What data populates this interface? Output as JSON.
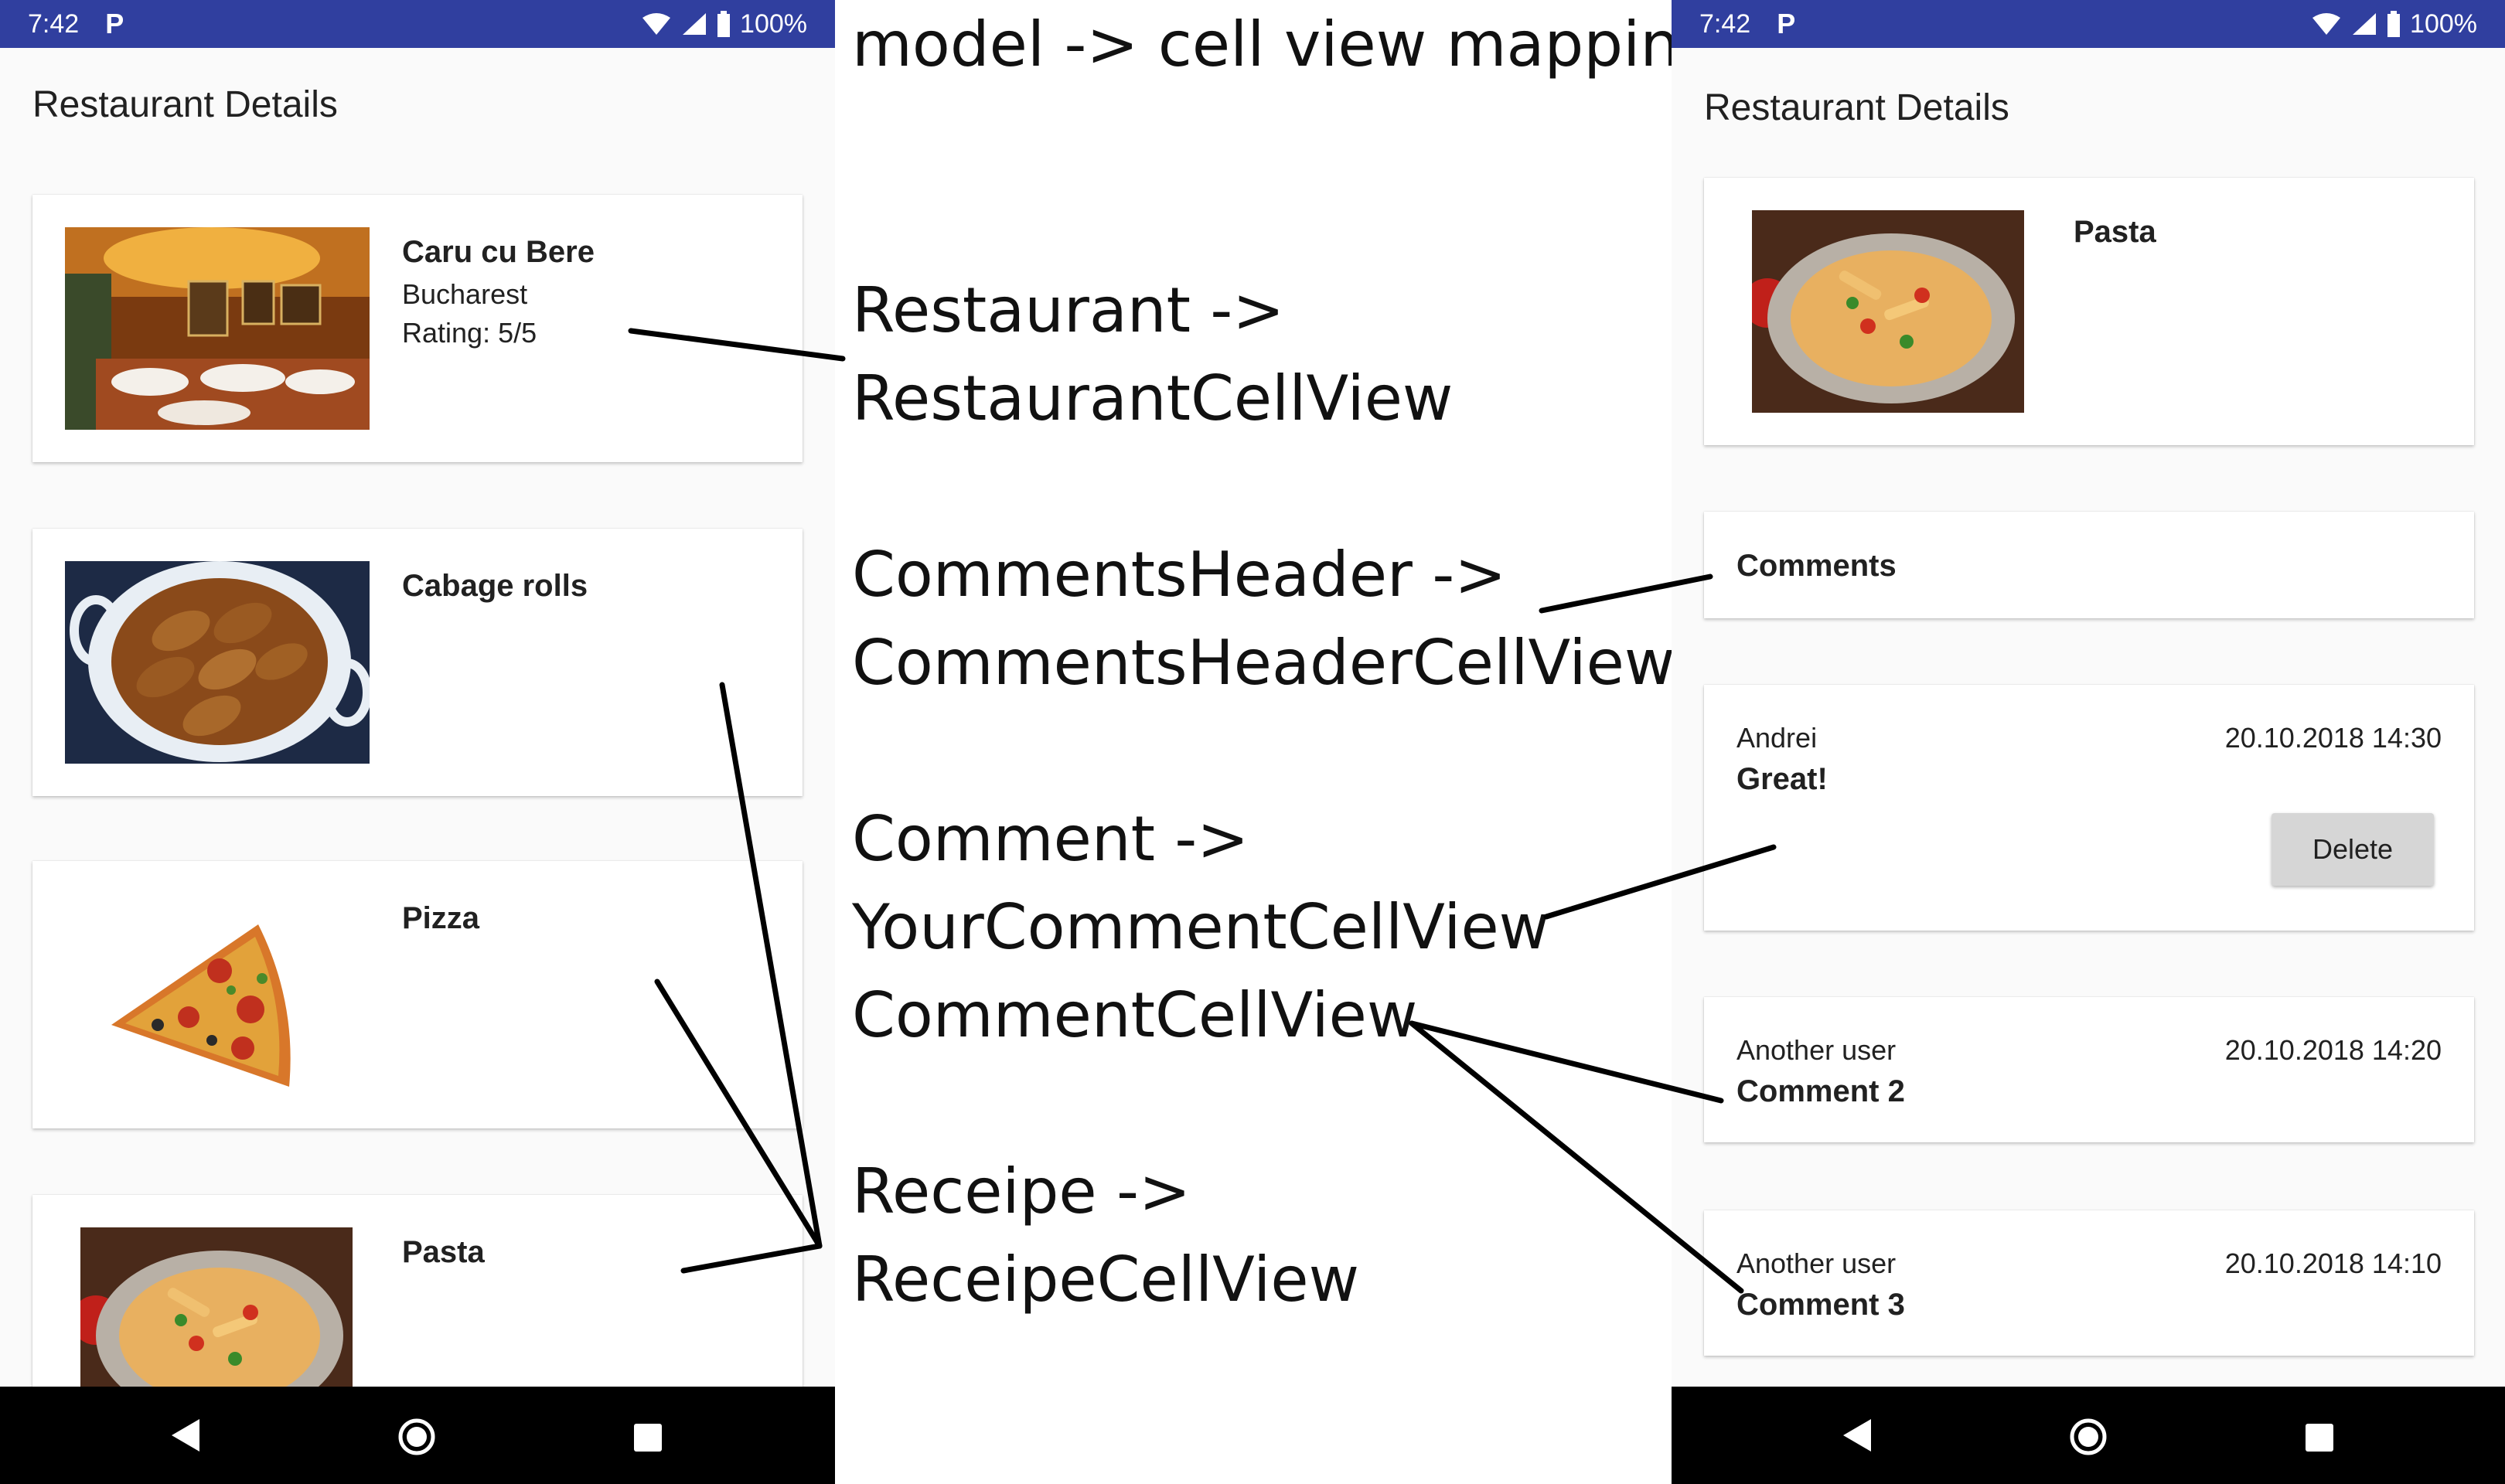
{
  "status_bar": {
    "time": "7:42",
    "battery": "100%"
  },
  "left_screen": {
    "title": "Restaurant Details",
    "cards": [
      {
        "title": "Caru cu Bere",
        "subtitle": "Bucharest",
        "rating": "Rating: 5/5",
        "image": "restaurant-interior-photo"
      },
      {
        "title": "Cabage rolls",
        "image": "cabbage-rolls-photo"
      },
      {
        "title": "Pizza",
        "image": "pizza-slice-photo"
      },
      {
        "title": "Pasta",
        "image": "pasta-plate-photo"
      }
    ]
  },
  "annotations": {
    "header": "model -> cell view mappings",
    "restaurant_line1": "Restaurant ->",
    "restaurant_line2": "RestaurantCellView",
    "comments_header_line1": "CommentsHeader ->",
    "comments_header_line2": "CommentsHeaderCellView",
    "comment_line1": "Comment ->",
    "comment_line2": "YourCommentCellView",
    "comment_line3": "CommentCellView",
    "receipe_line1": "Receipe ->",
    "receipe_line2": "ReceipeCellView"
  },
  "right_screen": {
    "title": "Restaurant Details",
    "recipe_card": {
      "title": "Pasta",
      "image": "pasta-plate-photo"
    },
    "comments_header": "Comments",
    "comments": [
      {
        "author": "Andrei",
        "text": "Great!",
        "date": "20.10.2018 14:30",
        "delete_label": "Delete"
      },
      {
        "author": "Another user",
        "text": "Comment 2",
        "date": "20.10.2018 14:20"
      },
      {
        "author": "Another user",
        "text": "Comment 3",
        "date": "20.10.2018 14:10"
      }
    ]
  },
  "colors": {
    "status_bar": "#303f9f",
    "background": "#fafafa",
    "card": "#ffffff",
    "nav_bar": "#000000",
    "delete_button": "#d6d6d6"
  },
  "icons": [
    "wifi-icon",
    "signal-icon",
    "battery-icon",
    "back-icon",
    "home-icon",
    "recents-icon"
  ]
}
